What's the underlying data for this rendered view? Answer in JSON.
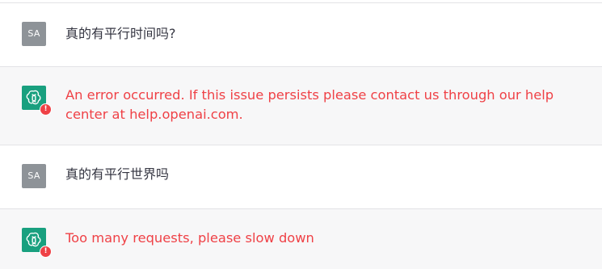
{
  "messages": [
    {
      "role": "user",
      "avatar_text": "SA",
      "text": "真的有平行时间吗?"
    },
    {
      "role": "assistant",
      "icon": "openai-logo-icon",
      "error": true,
      "badge": "!",
      "text": "An error occurred. If this issue persists please contact us through our help center at help.openai.com."
    },
    {
      "role": "user",
      "avatar_text": "SA",
      "text": "真的有平行世界吗"
    },
    {
      "role": "assistant",
      "icon": "openai-logo-icon",
      "error": true,
      "badge": "!",
      "text": "Too many requests, please slow down"
    }
  ],
  "colors": {
    "user_avatar": "#8e9398",
    "bot_avatar": "#19a07f",
    "error_text": "#ef4146",
    "bot_row_bg": "#f7f7f8"
  }
}
